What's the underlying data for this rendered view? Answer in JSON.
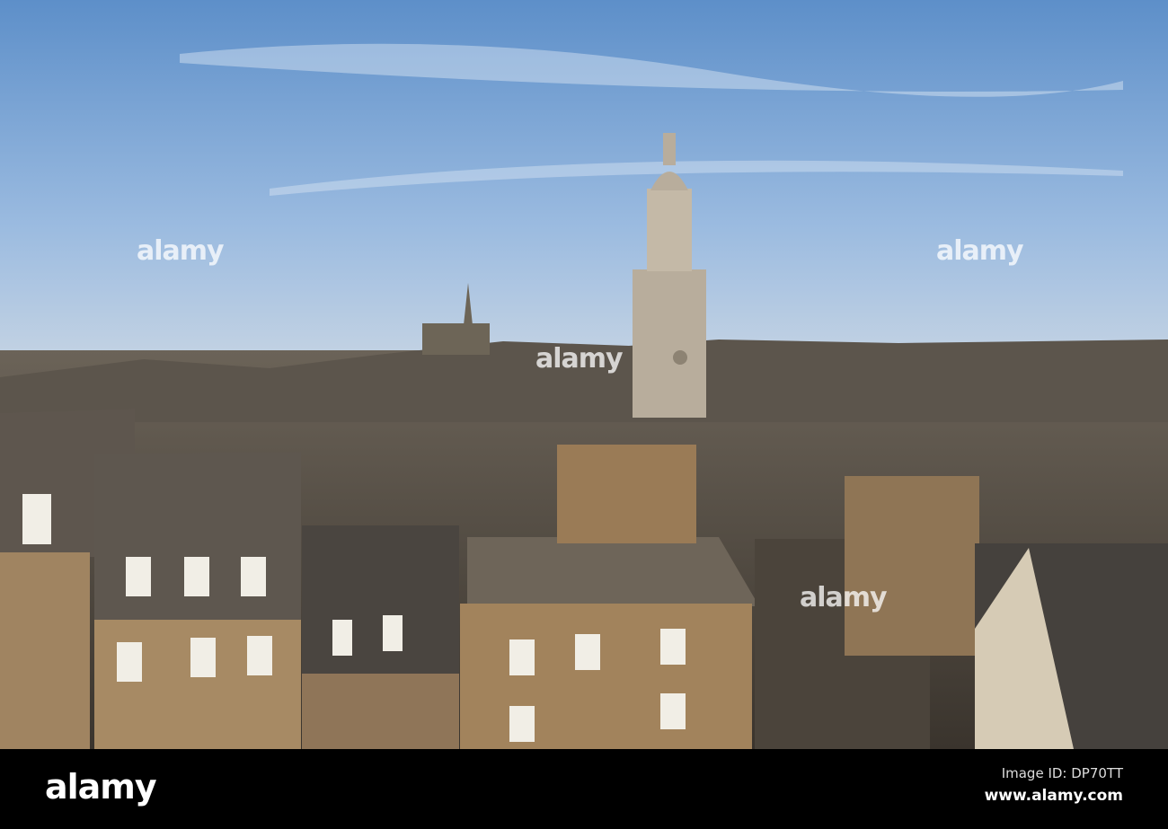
{
  "watermark": {
    "text": "alamy"
  },
  "footer": {
    "logo": "alamy",
    "image_id": "Image ID: DP70TT",
    "website": "www.alamy.com"
  }
}
